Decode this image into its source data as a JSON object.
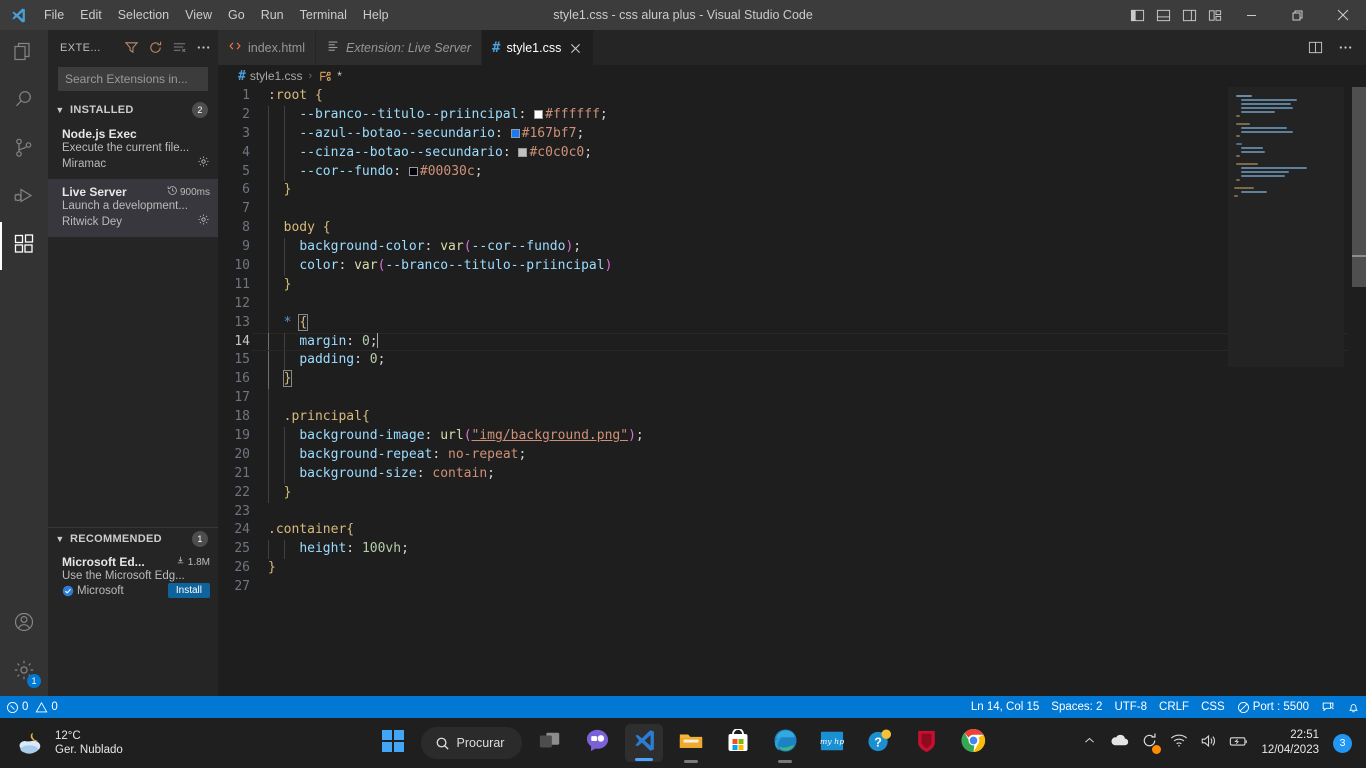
{
  "titlebar": {
    "window_title": "style1.css - css alura plus - Visual Studio Code",
    "menus": [
      "File",
      "Edit",
      "Selection",
      "View",
      "Go",
      "Run",
      "Terminal",
      "Help"
    ],
    "layout_icons": [
      "toggle-primary-sidebar-icon",
      "toggle-panel-icon",
      "toggle-secondary-sidebar-icon",
      "customize-layout-icon"
    ],
    "window_controls": [
      "minimize-button",
      "restore-button",
      "close-button"
    ]
  },
  "activitybar": {
    "items": [
      {
        "name": "explorer",
        "icon": "files-icon"
      },
      {
        "name": "search",
        "icon": "search-icon"
      },
      {
        "name": "source-control",
        "icon": "source-control-icon"
      },
      {
        "name": "run-and-debug",
        "icon": "run-debug-icon"
      },
      {
        "name": "extensions",
        "icon": "extensions-icon",
        "active": true
      }
    ],
    "bottom": [
      {
        "name": "accounts",
        "icon": "account-icon"
      },
      {
        "name": "settings",
        "icon": "gear-icon",
        "badge": "1"
      }
    ]
  },
  "sidebar": {
    "title": "EXTE...",
    "actions": [
      "filter-icon",
      "refresh-icon",
      "clear-search-results-icon",
      "more-actions-icon"
    ],
    "search": {
      "value": "",
      "placeholder": "Search Extensions in..."
    },
    "sections": [
      {
        "label": "INSTALLED",
        "count": "2",
        "items": [
          {
            "name": "Node.js Exec",
            "description": "Execute the current file...",
            "publisher": "Miramac",
            "meta": "",
            "action": "gear-icon",
            "selected": false
          },
          {
            "name": "Live Server",
            "description": "Launch a development...",
            "publisher": "Ritwick Dey",
            "meta": "900ms",
            "meta_icon": "history-icon",
            "action": "gear-icon",
            "selected": true
          }
        ]
      },
      {
        "label": "RECOMMENDED",
        "count": "1",
        "items": [
          {
            "name": "Microsoft Ed...",
            "description": "Use the Microsoft Edg...",
            "publisher": "Microsoft",
            "meta": "1.8M",
            "meta_icon": "install-count-icon",
            "verified": true,
            "install_label": "Install",
            "selected": false
          }
        ]
      }
    ]
  },
  "tabs": [
    {
      "label": "index.html",
      "icon": "html-file-icon",
      "active": false,
      "italic": false,
      "closable": false
    },
    {
      "label": "Extension: Live Server",
      "icon": "extension-page-icon",
      "active": false,
      "italic": true,
      "closable": false
    },
    {
      "label": "style1.css",
      "icon": "css-file-icon",
      "active": true,
      "italic": false,
      "closable": true
    }
  ],
  "tabbar_actions": [
    "split-editor-icon",
    "more-editor-actions-icon"
  ],
  "breadcrumb": {
    "file_icon": "css-file-icon",
    "file": "style1.css",
    "separator": "›",
    "symbol_icon": "css-symbol-icon",
    "symbol": "*"
  },
  "editor": {
    "language": "CSS",
    "lines": [
      {
        "n": "1",
        "text": ":root {"
      },
      {
        "n": "2",
        "text": "    --branco--titulo--priincipal: #ffffff;"
      },
      {
        "n": "3",
        "text": "    --azul--botao--secundario: #167bf7;"
      },
      {
        "n": "4",
        "text": "    --cinza--botao--secundario: #c0c0c0;"
      },
      {
        "n": "5",
        "text": "    --cor--fundo: #00030c;"
      },
      {
        "n": "6",
        "text": "  }"
      },
      {
        "n": "7",
        "text": ""
      },
      {
        "n": "8",
        "text": "  body {"
      },
      {
        "n": "9",
        "text": "    background-color: var(--cor--fundo);"
      },
      {
        "n": "10",
        "text": "    color: var(--branco--titulo--priincipal)"
      },
      {
        "n": "11",
        "text": "  }"
      },
      {
        "n": "12",
        "text": ""
      },
      {
        "n": "13",
        "text": "  * {"
      },
      {
        "n": "14",
        "text": "    margin: 0;"
      },
      {
        "n": "15",
        "text": "    padding: 0;"
      },
      {
        "n": "16",
        "text": "  }"
      },
      {
        "n": "17",
        "text": ""
      },
      {
        "n": "18",
        "text": "  .principal{"
      },
      {
        "n": "19",
        "text": "    background-image: url(\"img/background.png\");"
      },
      {
        "n": "20",
        "text": "    background-repeat: no-repeat;"
      },
      {
        "n": "21",
        "text": "    background-size: contain;"
      },
      {
        "n": "22",
        "text": "  }"
      },
      {
        "n": "23",
        "text": ""
      },
      {
        "n": "24",
        "text": ".container{"
      },
      {
        "n": "25",
        "text": "    height: 100vh;"
      },
      {
        "n": "26",
        "text": "}"
      },
      {
        "n": "27",
        "text": ""
      }
    ],
    "cursor_line": 14,
    "color_swatches": {
      "white": "#ffffff",
      "blue": "#167bf7",
      "gray": "#c0c0c0",
      "dark": "#00030c"
    }
  },
  "statusbar": {
    "left": [
      {
        "name": "problems",
        "icon": "error-icon",
        "text": "0",
        "icon2": "warning-icon",
        "text2": "0"
      }
    ],
    "right": [
      {
        "name": "cursor-position",
        "text": "Ln 14, Col 15"
      },
      {
        "name": "indentation",
        "text": "Spaces: 2"
      },
      {
        "name": "encoding",
        "text": "UTF-8"
      },
      {
        "name": "eol",
        "text": "CRLF"
      },
      {
        "name": "language-mode",
        "text": "CSS"
      },
      {
        "name": "live-server-port",
        "text": "Port : 5500",
        "icon": "go-live-icon"
      },
      {
        "name": "feedback",
        "text": "",
        "icon": "tweet-feedback-icon"
      },
      {
        "name": "notifications",
        "text": "",
        "icon": "bell-icon"
      }
    ]
  },
  "taskbar": {
    "weather": {
      "temperature": "12°C",
      "condition": "Ger. Nublado",
      "icon": "partly-cloudy-night-icon"
    },
    "search_placeholder": "Procurar",
    "apps": [
      {
        "name": "start-button",
        "icon": "windows-logo-icon"
      },
      {
        "name": "task-view",
        "icon": "task-view-icon"
      },
      {
        "name": "microsoft-teams",
        "icon": "teams-chat-icon"
      },
      {
        "name": "visual-studio-code",
        "icon": "vscode-icon",
        "active": true
      },
      {
        "name": "file-explorer",
        "icon": "folder-icon",
        "running": true
      },
      {
        "name": "microsoft-store",
        "icon": "store-icon"
      },
      {
        "name": "microsoft-edge",
        "icon": "edge-icon",
        "running": true
      },
      {
        "name": "my-hp",
        "icon": "myhp-icon"
      },
      {
        "name": "get-help",
        "icon": "get-help-icon"
      },
      {
        "name": "mcafee",
        "icon": "mcafee-icon"
      },
      {
        "name": "google-chrome",
        "icon": "chrome-icon"
      }
    ],
    "tray": [
      {
        "name": "show-hidden-icons",
        "icon": "chevron-up-icon"
      },
      {
        "name": "onedrive",
        "icon": "cloud-icon"
      },
      {
        "name": "windows-update",
        "icon": "update-icon"
      },
      {
        "name": "network",
        "icon": "wifi-icon"
      },
      {
        "name": "volume",
        "icon": "speaker-icon"
      },
      {
        "name": "battery",
        "icon": "battery-charging-icon"
      }
    ],
    "clock": {
      "time": "22:51",
      "date": "12/04/2023"
    },
    "notification_count": "3"
  },
  "colors": {
    "accent": "#0078d4",
    "titlebar_bg": "#3c3c3c",
    "sidebar_bg": "#252526",
    "editor_bg": "#1e1e1e",
    "activitybar_bg": "#333333",
    "taskbar_bg": "#1f1f1f"
  }
}
